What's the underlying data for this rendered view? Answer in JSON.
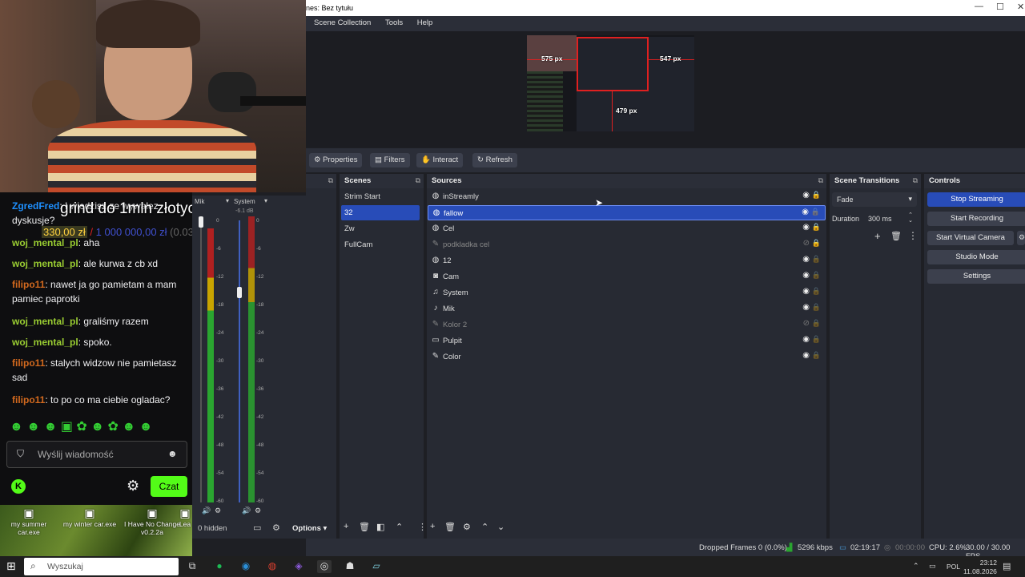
{
  "window": {
    "title": "nes: Bez tytułu",
    "minimize": "—",
    "maximize": "☐",
    "close": "✕"
  },
  "menu": [
    "Scene Collection",
    "Tools",
    "Help"
  ],
  "preview": {
    "left_px": "575 px",
    "right_px": "547 px",
    "bottom_px": "479 px"
  },
  "source_toolbar": {
    "properties": "Properties",
    "filters": "Filters",
    "interact": "Interact",
    "refresh": "Refresh"
  },
  "scenes": {
    "title": "Scenes",
    "items": [
      {
        "name": "Strim Start",
        "selected": false
      },
      {
        "name": "32",
        "selected": true
      },
      {
        "name": "Zw",
        "selected": false
      },
      {
        "name": "FullCam",
        "selected": false
      }
    ]
  },
  "sources": {
    "title": "Sources",
    "items": [
      {
        "name": "inStreamly",
        "icon": "globe-icon",
        "visible": true,
        "locked": true,
        "selected": false,
        "dim": false
      },
      {
        "name": "fallow",
        "icon": "globe-icon",
        "visible": true,
        "locked": false,
        "selected": true,
        "dim": false
      },
      {
        "name": "Cel",
        "icon": "globe-icon",
        "visible": true,
        "locked": true,
        "selected": false,
        "dim": false
      },
      {
        "name": "podkladka cel",
        "icon": "brush-icon",
        "visible": false,
        "locked": true,
        "selected": false,
        "dim": true
      },
      {
        "name": "12",
        "icon": "globe-icon",
        "visible": true,
        "locked": false,
        "selected": false,
        "dim": false
      },
      {
        "name": "Cam",
        "icon": "camera-icon",
        "visible": true,
        "locked": false,
        "selected": false,
        "dim": false
      },
      {
        "name": "System",
        "icon": "speaker-icon",
        "visible": true,
        "locked": false,
        "selected": false,
        "dim": false
      },
      {
        "name": "Mik",
        "icon": "mic-icon",
        "visible": true,
        "locked": false,
        "selected": false,
        "dim": false
      },
      {
        "name": "Kolor 2",
        "icon": "brush-icon",
        "visible": false,
        "locked": false,
        "selected": false,
        "dim": true
      },
      {
        "name": "Pulpit",
        "icon": "monitor-icon",
        "visible": true,
        "locked": false,
        "selected": false,
        "dim": false
      },
      {
        "name": "Color",
        "icon": "brush-icon",
        "visible": true,
        "locked": false,
        "selected": false,
        "dim": false
      }
    ]
  },
  "transitions": {
    "title": "Scene Transitions",
    "type": "Fade",
    "duration_label": "Duration",
    "duration": "300 ms"
  },
  "controls": {
    "title": "Controls",
    "stop_streaming": "Stop Streaming",
    "start_recording": "Start Recording",
    "start_virtual_camera": "Start Virtual Camera",
    "studio_mode": "Studio Mode",
    "settings": "Settings"
  },
  "mixer": {
    "mic_label": "Mik",
    "system_label": "System",
    "mic_db": "-6.1 dB",
    "hidden": "0 hidden",
    "options": "Options",
    "ticks": [
      "0",
      "-6",
      "-12",
      "-18",
      "-24",
      "-30",
      "-36",
      "-42",
      "-48",
      "-54",
      "-60"
    ]
  },
  "status": {
    "dropped": "Dropped Frames 0 (0.0%)",
    "kbps": "5296 kbps",
    "stream_time": "02:19:17",
    "rec_time": "00:00:00",
    "cpu": "CPU: 2.6%",
    "fps": "30.00 / 30.00 FPS"
  },
  "overlay": {
    "goal_title": "grind do 1mln złotych",
    "goal_current": "330,00 zł",
    "goal_sep": "/",
    "goal_target": "1 000 000,00 zł",
    "goal_pct": "(0.03%)"
  },
  "chat": {
    "messages": [
      {
        "user": "ZgredFred",
        "text": ": I wiedzisz ze wywalez dyskusje?",
        "color": "#1e90ff"
      },
      {
        "user": "woj_mental_pl",
        "text": ": aha",
        "color": "#9acd32"
      },
      {
        "user": "woj_mental_pl",
        "text": ": ale kurwa z cb xd",
        "color": "#9acd32"
      },
      {
        "user": "filipo11",
        "text": ": nawet ja go pamietam a mam pamiec paprotki",
        "color": "#d2691e"
      },
      {
        "user": "woj_mental_pl",
        "text": ": graliśmy razem",
        "color": "#9acd32"
      },
      {
        "user": "woj_mental_pl",
        "text": ": spoko.",
        "color": "#9acd32"
      },
      {
        "user": "filipo11",
        "text": ": stalych widzow nie pamietasz sad",
        "color": "#d2691e"
      },
      {
        "user": "filipo11",
        "text": ": to po co ma ciebie ogladac?",
        "color": "#d2691e"
      }
    ],
    "placeholder": "Wyślij wiadomość",
    "send": "Czat"
  },
  "desktop_icons": [
    "my summer car.exe",
    "my winter car.exe",
    "I Have No Change v0.2.2a",
    "Lea"
  ],
  "taskbar": {
    "search": "Wyszukaj",
    "lang": "POL",
    "time": "23:12",
    "date": "11.08.2026"
  }
}
